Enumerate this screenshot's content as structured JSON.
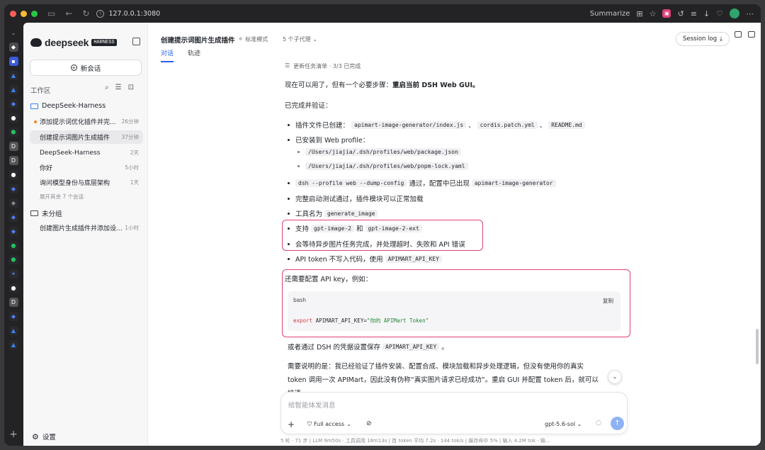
{
  "browser": {
    "url": "127.0.0.1:3080",
    "summarize_label": "Summarize"
  },
  "sidebar": {
    "logo_text": "deepseek",
    "logo_badge": "HARNESS",
    "new_chat": "新会话",
    "workspace_label": "工作区",
    "project": "DeepSeek-Harness",
    "conversations": [
      {
        "title": "添加提示词优化插件并完...",
        "time": "26分钟",
        "running": true
      },
      {
        "title": "创建提示词图片生成插件",
        "time": "37分钟",
        "active": true
      },
      {
        "title": "DeepSeek-Harness",
        "time": "2天"
      },
      {
        "title": "你好",
        "time": "5小时"
      },
      {
        "title": "询问模型身份与底层架构",
        "time": "1天"
      }
    ],
    "expand_more": "展开其余 7 个会话",
    "ungrouped": "未分组",
    "ungrouped_conversations": [
      {
        "title": "创建图片生成插件并添加设...",
        "time": "1小时"
      }
    ],
    "settings": "设置"
  },
  "header": {
    "title": "创建提示词图片生成插件",
    "mode": "标准模式",
    "agents": "5 个子代理",
    "tabs": [
      "对话",
      "轨迹"
    ],
    "session_log": "Session log"
  },
  "message": {
    "task_update": "更新任务清单 · 3/3 已完成",
    "intro_prefix": "现在可以用了，但有一个必要步骤：",
    "intro_bold": "重启当前 DSH Web GUI。",
    "done_heading": "已完成并验证：",
    "b1_text": "插件文件已创建：",
    "b1_code1": "apimart-image-generator/index.js",
    "b1_sep1": "、",
    "b1_code2": "cordis.patch.yml",
    "b1_sep2": "、",
    "b1_code3": "README.md",
    "b2_text": "已安装到 Web profile：",
    "b2_sub1": "/Users/jiajia/.dsh/profiles/web/package.json",
    "b2_sub2": "/Users/jiajia/.dsh/profiles/web/pnpm-lock.yaml",
    "b3_code1": "dsh --profile web --dump-config",
    "b3_text": "通过，配置中已出现",
    "b3_code2": "apimart-image-generator",
    "b4_text": "完整启动测试通过，插件模块可以正常加载",
    "b5_text": "工具名为",
    "b5_code": "generate_image",
    "b6_text1": "支持",
    "b6_code1": "gpt-image-2",
    "b6_text2": "和",
    "b6_code2": "gpt-image-2-ext",
    "b7_text": "会等待异步图片任务完成，并处理超时、失败和 API 错误",
    "b8_text": "API token 不写入代码，使用",
    "b8_code": "APIMART_API_KEY",
    "config_heading": "还需要配置 API key，例如：",
    "code_lang": "bash",
    "code_copy": "复制",
    "code_kw": "export",
    "code_var": " APIMART_API_KEY=",
    "code_str": "\"你的 APIMart Token\"",
    "alt_text1": "或者通过 DSH 的凭据设置保存",
    "alt_code": "APIMART_API_KEY",
    "alt_text2": "。",
    "note_line1": "需要说明的是：我已经验证了插件安装、配置合成、模块加载和异步处理逻辑，但没有使用你的真实",
    "note_line2": "token 调用一次 APIMart，因此没有伪称“真实图片请求已经成功”。重启 GUI 并配置 token 后，就可以",
    "note_line3": "接语"
  },
  "composer": {
    "placeholder": "给智能体发消息",
    "access": "Full access",
    "model": "gpt-5.6-sol"
  },
  "status_bar": "5 轮 · 71 步  |  LLM 9m50s · 工具调用 18m13s  |  首 token 平均 7.2s · 144 tok/s  |  缓存命中 5%  |  输入 4.2M tok · 输..."
}
